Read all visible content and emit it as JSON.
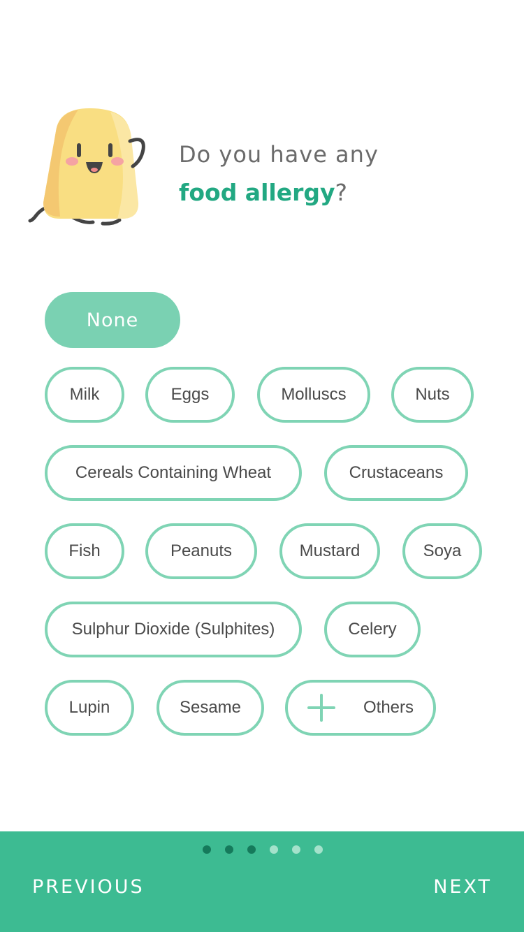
{
  "question": {
    "line1": "Do you have any",
    "highlight": "food allergy",
    "suffix": "?"
  },
  "options": {
    "none": "None",
    "milk": "Milk",
    "eggs": "Eggs",
    "molluscs": "Molluscs",
    "nuts": "Nuts",
    "cereals": "Cereals Containing Wheat",
    "crustaceans": "Crustaceans",
    "fish": "Fish",
    "peanuts": "Peanuts",
    "mustard": "Mustard",
    "soya": "Soya",
    "sulphur": "Sulphur Dioxide (Sulphites)",
    "celery": "Celery",
    "lupin": "Lupin",
    "sesame": "Sesame",
    "others": "Others"
  },
  "selected_option": "None",
  "footer": {
    "previous": "PREVIOUS",
    "next": "NEXT",
    "pagination": {
      "completed_steps": 3,
      "total_steps": 6
    }
  },
  "colors": {
    "accent": "#3dbb92",
    "highlight_text": "#22a882",
    "chip_border": "#7fd4b4",
    "selected_chip": "#7ad1b2"
  },
  "icons": [
    "mascot-illustration",
    "plus-icon"
  ]
}
